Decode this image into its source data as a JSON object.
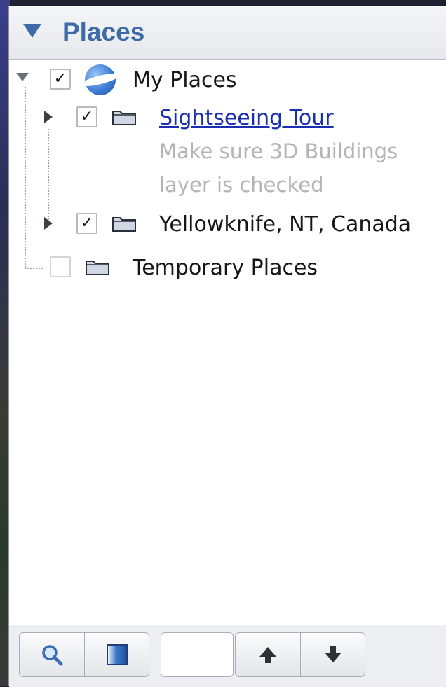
{
  "header": {
    "title": "Places"
  },
  "tree": {
    "root": {
      "label": "My Places",
      "checked": true,
      "expanded": true,
      "icon": "google-earth-globe-icon"
    },
    "children": [
      {
        "label": "Sightseeing Tour",
        "checked": true,
        "expanded": false,
        "icon": "folder-icon",
        "is_link": true,
        "description_line1": "Make sure 3D Buildings",
        "description_line2": "layer is checked"
      },
      {
        "label": "Yellowknife, NT, Canada",
        "checked": true,
        "expanded": false,
        "icon": "folder-icon"
      }
    ],
    "temporary": {
      "label": "Temporary Places",
      "checked": false,
      "icon": "folder-icon"
    }
  },
  "checkmark_glyph": "✓",
  "toolbar": {
    "buttons": [
      "search-icon",
      "sidebar-toggle-icon",
      "arrow-up-icon",
      "arrow-down-icon"
    ]
  },
  "colors": {
    "accent": "#3f6aa8",
    "link": "#1a2fb0",
    "description": "#b4b4b4"
  }
}
